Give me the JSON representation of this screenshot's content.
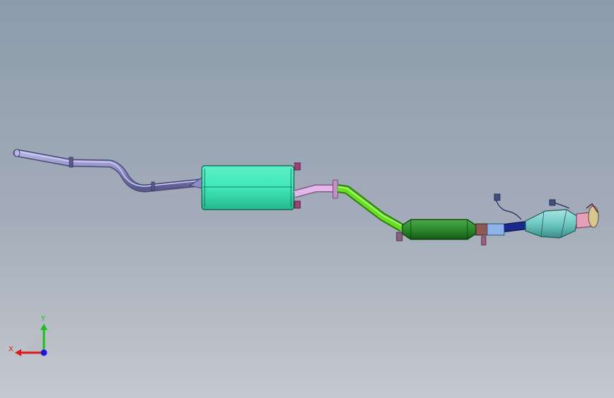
{
  "viewport": {
    "background_top": "#8d9baa",
    "background_bottom": "#c4c8d0"
  },
  "model": {
    "parts": [
      {
        "name": "tailpipe",
        "color": "#8c8cc4"
      },
      {
        "name": "rear-muffler",
        "color": "#3fe8b8"
      },
      {
        "name": "connector-pipe",
        "color": "#e2b8e8"
      },
      {
        "name": "intermediate-pipe",
        "color": "#66e020"
      },
      {
        "name": "center-resonator",
        "color": "#2d8a2d"
      },
      {
        "name": "flex-joint",
        "color": "#8c5a55"
      },
      {
        "name": "front-pipe",
        "color": "#1a2a8c"
      },
      {
        "name": "catalytic-converter",
        "color": "#6ec8c4"
      },
      {
        "name": "manifold-flange",
        "color": "#e8a0b8"
      }
    ]
  },
  "triad": {
    "x_label": "X",
    "y_label": "Y",
    "x_color": "#e01818",
    "y_color": "#18c018",
    "z_color": "#1818e0"
  }
}
